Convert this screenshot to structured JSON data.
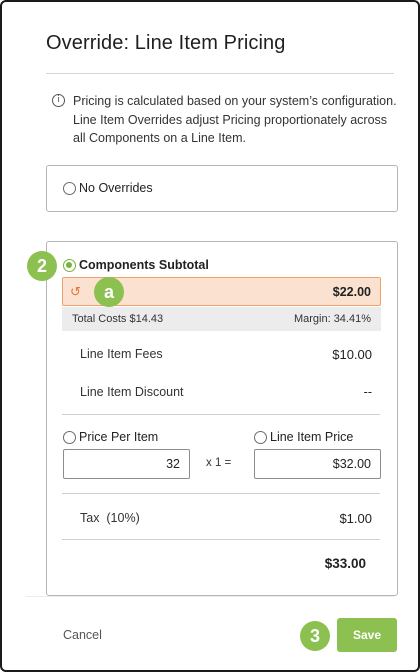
{
  "dialog": {
    "title": "Override: Line Item Pricing",
    "info_text": "Pricing is calculated based on your system’s configuration. Line Item Overrides adjust Pricing proportionately across all Components on a Line Item."
  },
  "options": {
    "no_overrides_label": "No Overrides",
    "components_subtotal_label": "Components Subtotal",
    "selected": "Components Subtotal"
  },
  "subtotal": {
    "value": "$22.00",
    "total_costs": "Total Costs $14.43",
    "margin": "Margin: 34.41%"
  },
  "fees": {
    "label": "Line Item Fees",
    "value": "$10.00"
  },
  "discount": {
    "label": "Line Item Discount",
    "value": "--"
  },
  "pricing": {
    "price_per_item_label": "Price Per Item",
    "price_per_item_value": "32",
    "multiplier": "x 1 =",
    "line_item_price_label": "Line Item Price",
    "line_item_price_value": "$32.00"
  },
  "tax": {
    "label": "Tax  (10%)",
    "value": "$1.00"
  },
  "total": "$33.00",
  "footer": {
    "cancel_label": "Cancel",
    "save_label": "Save"
  },
  "callouts": {
    "two": "2",
    "a": "a",
    "three": "3"
  },
  "colors": {
    "accent_green": "#8cc151",
    "override_bg": "#fbe1cf",
    "override_border": "#f0a06b"
  }
}
